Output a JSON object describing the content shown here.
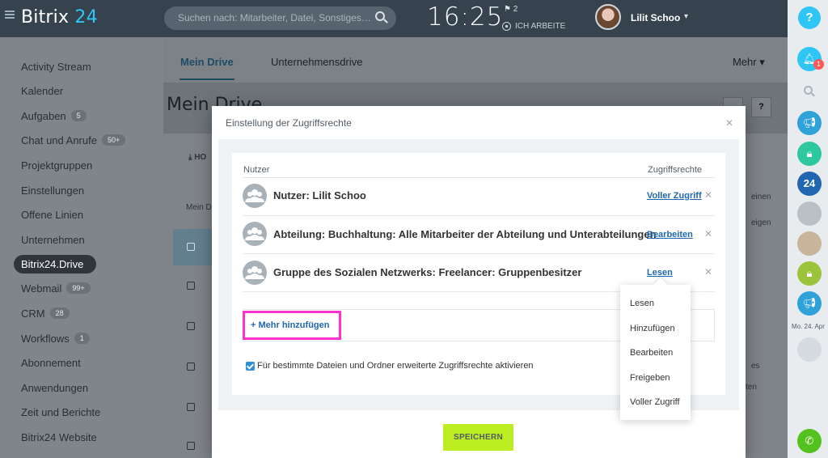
{
  "header": {
    "logo_a": "Bitrix",
    "logo_b": "24",
    "search_placeholder": "Suchen nach: Mitarbeiter, Datei, Sonstiges…",
    "clock": "16:25",
    "flag_count": "2",
    "work_status": "ICH ARBEITE",
    "user_name": "Lilit Schoo"
  },
  "sidebar": {
    "items": [
      {
        "label": "Activity Stream",
        "badge": ""
      },
      {
        "label": "Kalender",
        "badge": ""
      },
      {
        "label": "Aufgaben",
        "badge": "5"
      },
      {
        "label": "Chat und Anrufe",
        "badge": "50+"
      },
      {
        "label": "Projektgruppen",
        "badge": ""
      },
      {
        "label": "Einstellungen",
        "badge": ""
      },
      {
        "label": "Offene Linien",
        "badge": ""
      },
      {
        "label": "Unternehmen",
        "badge": ""
      },
      {
        "label": "Bitrix24.Drive",
        "badge": ""
      },
      {
        "label": "Webmail",
        "badge": "99+"
      },
      {
        "label": "CRM",
        "badge": "28"
      },
      {
        "label": "Workflows",
        "badge": "1"
      },
      {
        "label": "Abonnement",
        "badge": ""
      },
      {
        "label": "Anwendungen",
        "badge": ""
      },
      {
        "label": "Zeit und Berichte",
        "badge": ""
      },
      {
        "label": "Bitrix24 Website",
        "badge": ""
      }
    ]
  },
  "main": {
    "tabs": [
      "Mein Drive",
      "Unternehmensdrive"
    ],
    "more": "Mehr",
    "title": "Mein Drive",
    "toolbar_label": "HO",
    "column_label": "Mein D",
    "bg_text_right": [
      "einen",
      "eigen",
      "es",
      "ten"
    ]
  },
  "modal": {
    "title": "Einstellung der Zugriffsrechte",
    "col_user": "Nutzer",
    "col_rights": "Zugriffsrechte",
    "rows": [
      {
        "name": "Nutzer: Lilit Schoo",
        "permission": "Voller Zugriff"
      },
      {
        "name": "Abteilung: Buchhaltung: Alle Mitarbeiter der Abteilung und Unterabteilungen",
        "permission": "Bearbeiten"
      },
      {
        "name": "Gruppe des Sozialen Netzwerks: Freelancer: Gruppenbesitzer",
        "permission": "Lesen"
      }
    ],
    "add_more": "+ Mehr hinzufügen",
    "checkbox_label": "Für bestimmte Dateien und Ordner erweiterte Zugriffsrechte aktivieren",
    "save": "SPEICHERN"
  },
  "dropdown": {
    "options": [
      "Lesen",
      "Hinzufügen",
      "Bearbeiten",
      "Freigeben",
      "Voller Zugriff"
    ]
  },
  "right_panel": {
    "date": "Mo. 24. Apr",
    "notification_count": "1"
  },
  "colors": {
    "accent": "#2fc6f6",
    "link": "#2067b0",
    "save": "#bbed21",
    "highlight": "#ff33cc"
  }
}
